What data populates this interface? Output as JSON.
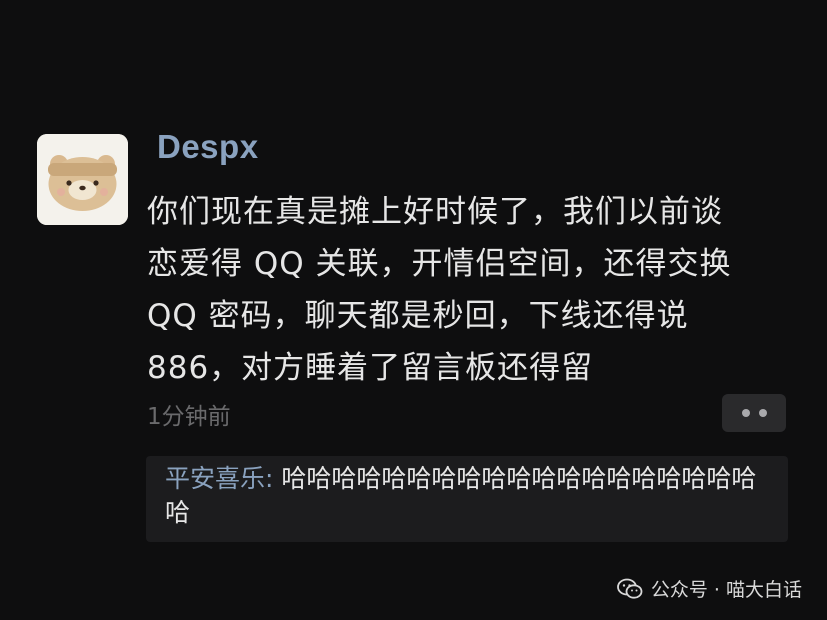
{
  "post": {
    "username": "Despx",
    "text_lines": [
      "你们现在真是摊上好时候了，我们以前谈",
      "恋爱得 QQ 关联，开情侣空间，还得交换",
      "QQ 密码，聊天都是秒回，下线还得说",
      "886，对方睡着了留言板还得留"
    ],
    "timestamp": "1分钟前",
    "more_icon": "more-dots-icon"
  },
  "comment": {
    "author": "平安喜乐",
    "separator": ": ",
    "text": "哈哈哈哈哈哈哈哈哈哈哈哈哈哈哈哈哈哈哈哈"
  },
  "watermark": {
    "text": "公众号 · 喵大白话",
    "icon": "wechat-icon"
  },
  "colors": {
    "background": "#0e0e0f",
    "name_blue": "#8aa2bf",
    "text": "#e6e6e6",
    "muted": "#6a6a6c",
    "comment_bg": "#1c1c1e"
  }
}
